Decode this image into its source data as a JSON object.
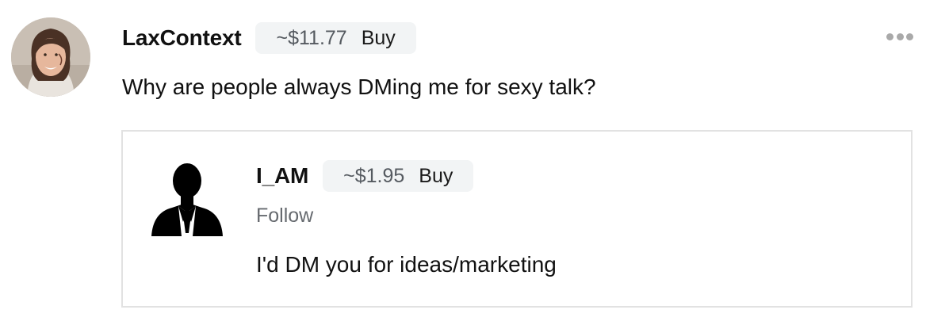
{
  "post": {
    "author": "LaxContext",
    "price": "~$11.77",
    "buy_label": "Buy",
    "text": "Why are people always DMing me for sexy talk?",
    "more_icon": "more-horizontal-icon"
  },
  "reply": {
    "author": "I_AM",
    "price": "~$1.95",
    "buy_label": "Buy",
    "follow_label": "Follow",
    "text": "I'd DM you for ideas/marketing",
    "avatar_icon": "person-silhouette-icon"
  },
  "colors": {
    "pill_bg": "#f2f4f5",
    "card_border": "#e2e2e2",
    "muted_text": "#666a6f"
  }
}
